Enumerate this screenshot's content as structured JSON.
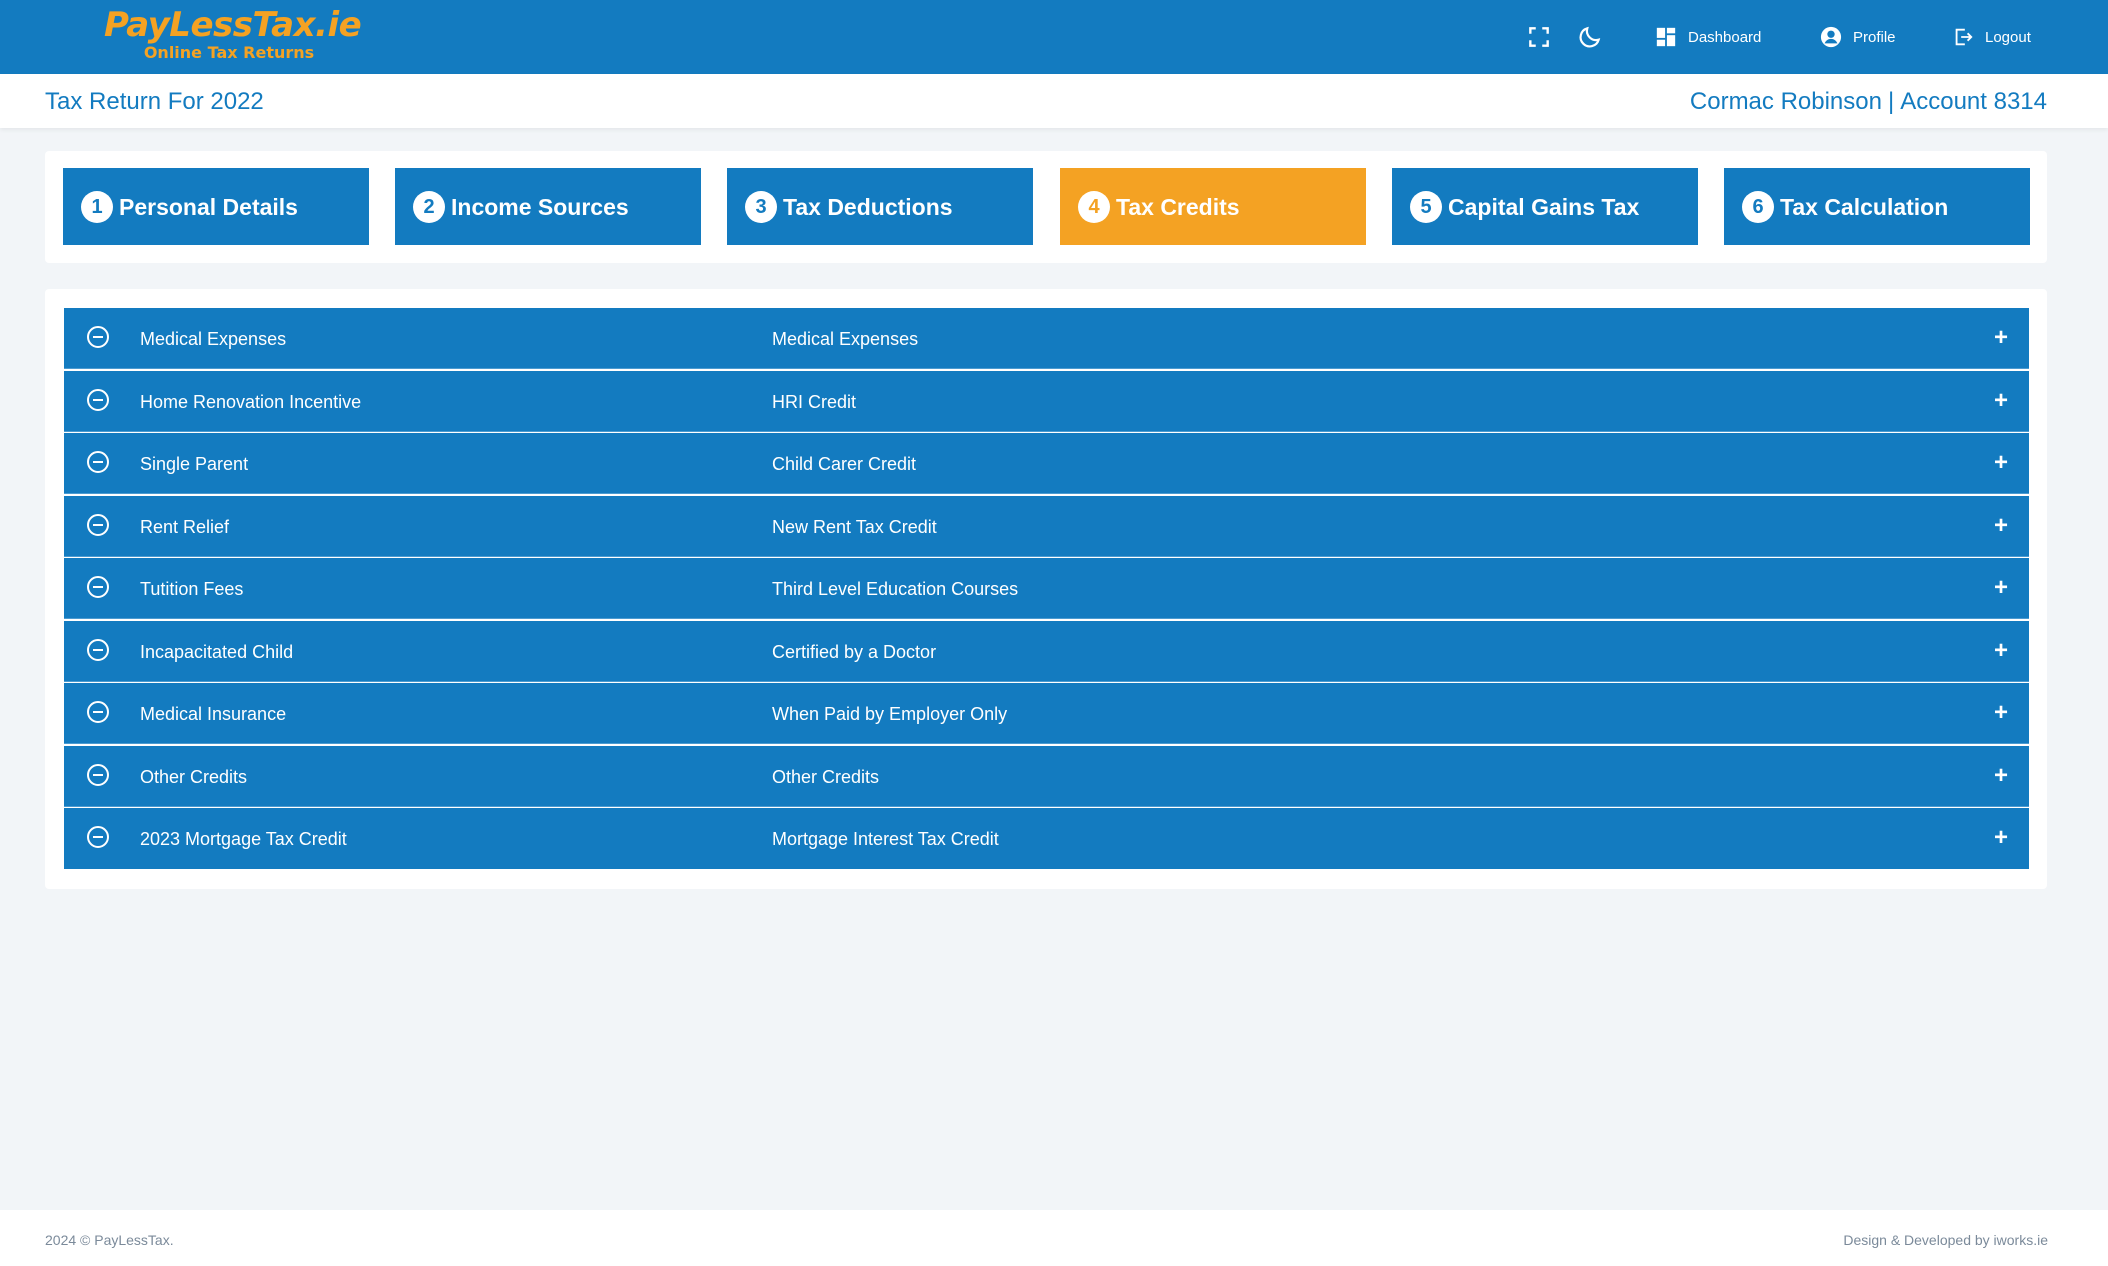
{
  "brand": {
    "name": "PayLessTax.ie",
    "tagline": "Online Tax Returns",
    "primary_color": "#137bc0",
    "accent_color": "#f4a223"
  },
  "topnav": {
    "fullscreen_icon": "fullscreen-icon",
    "theme_icon": "moon-icon",
    "items": [
      {
        "label": "Dashboard",
        "icon": "dashboard-icon"
      },
      {
        "label": "Profile",
        "icon": "user-circle-icon"
      },
      {
        "label": "Logout",
        "icon": "logout-icon"
      }
    ]
  },
  "header": {
    "title": "Tax Return For 2022",
    "user_name": "Cormac Robinson",
    "separator": "|",
    "account": "Account 8314"
  },
  "steps": [
    {
      "number": "1",
      "label": "Personal Details",
      "active": false
    },
    {
      "number": "2",
      "label": "Income Sources",
      "active": false
    },
    {
      "number": "3",
      "label": "Tax Deductions",
      "active": false
    },
    {
      "number": "4",
      "label": "Tax Credits",
      "active": true
    },
    {
      "number": "5",
      "label": "Capital Gains Tax",
      "active": false
    },
    {
      "number": "6",
      "label": "Tax Calculation",
      "active": false
    }
  ],
  "credits": [
    {
      "title": "Medical Expenses",
      "description": "Medical Expenses"
    },
    {
      "title": "Home Renovation Incentive",
      "description": "HRI Credit"
    },
    {
      "title": "Single Parent",
      "description": "Child Carer Credit"
    },
    {
      "title": "Rent Relief",
      "description": "New Rent Tax Credit"
    },
    {
      "title": "Tutition Fees",
      "description": "Third Level Education Courses"
    },
    {
      "title": "Incapacitated Child",
      "description": "Certified by a Doctor"
    },
    {
      "title": "Medical Insurance",
      "description": "When Paid by Employer Only"
    },
    {
      "title": "Other Credits",
      "description": "Other Credits"
    },
    {
      "title": "2023 Mortgage Tax Credit",
      "description": "Mortgage Interest Tax Credit"
    }
  ],
  "row_icons": {
    "left": "minus-circle-icon",
    "right": "plus-icon",
    "plus_glyph": "+"
  },
  "footer": {
    "copyright": "2024 © PayLessTax.",
    "credit": "Design & Developed by iworks.ie"
  }
}
